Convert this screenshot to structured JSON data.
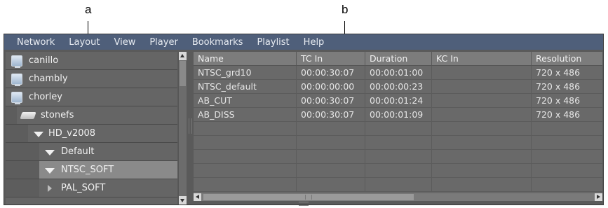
{
  "callouts": {
    "a": "a",
    "b": "b"
  },
  "menu": [
    "Network",
    "Layout",
    "View",
    "Player",
    "Bookmarks",
    "Playlist",
    "Help"
  ],
  "tree": {
    "items": [
      {
        "label": "canillo",
        "icon": "monitor-icon"
      },
      {
        "label": "chambly",
        "icon": "monitor-icon"
      },
      {
        "label": "chorley",
        "icon": "monitor-icon"
      },
      {
        "label": "stonefs",
        "icon": "disk-icon"
      },
      {
        "label": "HD_v2008",
        "icon": "triangle-down-icon"
      },
      {
        "label": "Default",
        "icon": "triangle-down-icon"
      },
      {
        "label": "NTSC_SOFT",
        "icon": "triangle-down-icon",
        "selected": true
      },
      {
        "label": "PAL_SOFT",
        "icon": "triangle-right-icon"
      }
    ]
  },
  "table": {
    "columns": [
      "Name",
      "TC In",
      "Duration",
      "KC In",
      "Resolution"
    ],
    "rows": [
      [
        "NTSC_grd10",
        "00:00:30:07",
        "00:00:01:00",
        "",
        "720 x 486"
      ],
      [
        "NTSC_default",
        "00:00:00:00",
        "00:00:00:23",
        "",
        "720 x 486"
      ],
      [
        "AB_CUT",
        "00:00:30:07",
        "00:00:01:24",
        "",
        "720 x 486"
      ],
      [
        "AB_DISS",
        "00:00:30:07",
        "00:00:01:09",
        "",
        "720 x 486"
      ],
      [
        "",
        "",
        "",
        "",
        ""
      ],
      [
        "",
        "",
        "",
        "",
        ""
      ],
      [
        "",
        "",
        "",
        "",
        ""
      ],
      [
        "",
        "",
        "",
        "",
        ""
      ],
      [
        "",
        "",
        "",
        "",
        ""
      ]
    ]
  },
  "colors": {
    "menubar": "#4f5f7a",
    "panel": "#656565",
    "selected": "#8a8a8a"
  }
}
